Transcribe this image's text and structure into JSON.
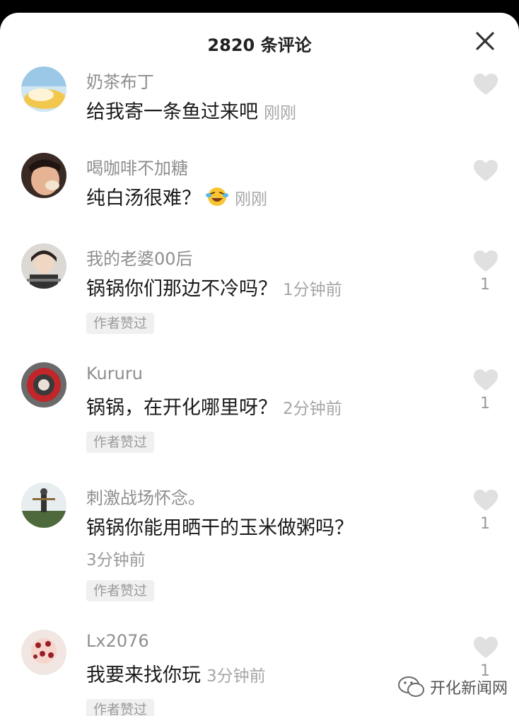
{
  "header": {
    "title": "2820 条评论"
  },
  "comments": [
    {
      "username": "奶茶布丁",
      "text": "给我寄一条鱼过来吧",
      "time": "刚刚"
    },
    {
      "username": "喝咖啡不加糖",
      "text": "纯白汤很难？",
      "time": "刚刚"
    },
    {
      "username": "我的老婆00后",
      "text": "锅锅你们那边不冷吗？",
      "time": "1分钟前",
      "badge": "作者赞过",
      "likes": "1"
    },
    {
      "username": "Kururu",
      "text": "锅锅，在开化哪里呀？",
      "time": "2分钟前",
      "badge": "作者赞过",
      "likes": "1"
    },
    {
      "username": "刺激战场怀念。",
      "text": "锅锅你能用晒干的玉米做粥吗？",
      "time": "3分钟前",
      "badge": "作者赞过",
      "likes": "1"
    },
    {
      "username": "Lx2076",
      "text": "我要来找你玩",
      "time": "3分钟前",
      "badge": "作者赞过",
      "likes": "1"
    }
  ],
  "watermark": {
    "text": "开化新闻网"
  },
  "icons": {
    "close": "close-icon",
    "like": "heart-icon",
    "emoji": "laughing-crying-emoji-icon"
  }
}
